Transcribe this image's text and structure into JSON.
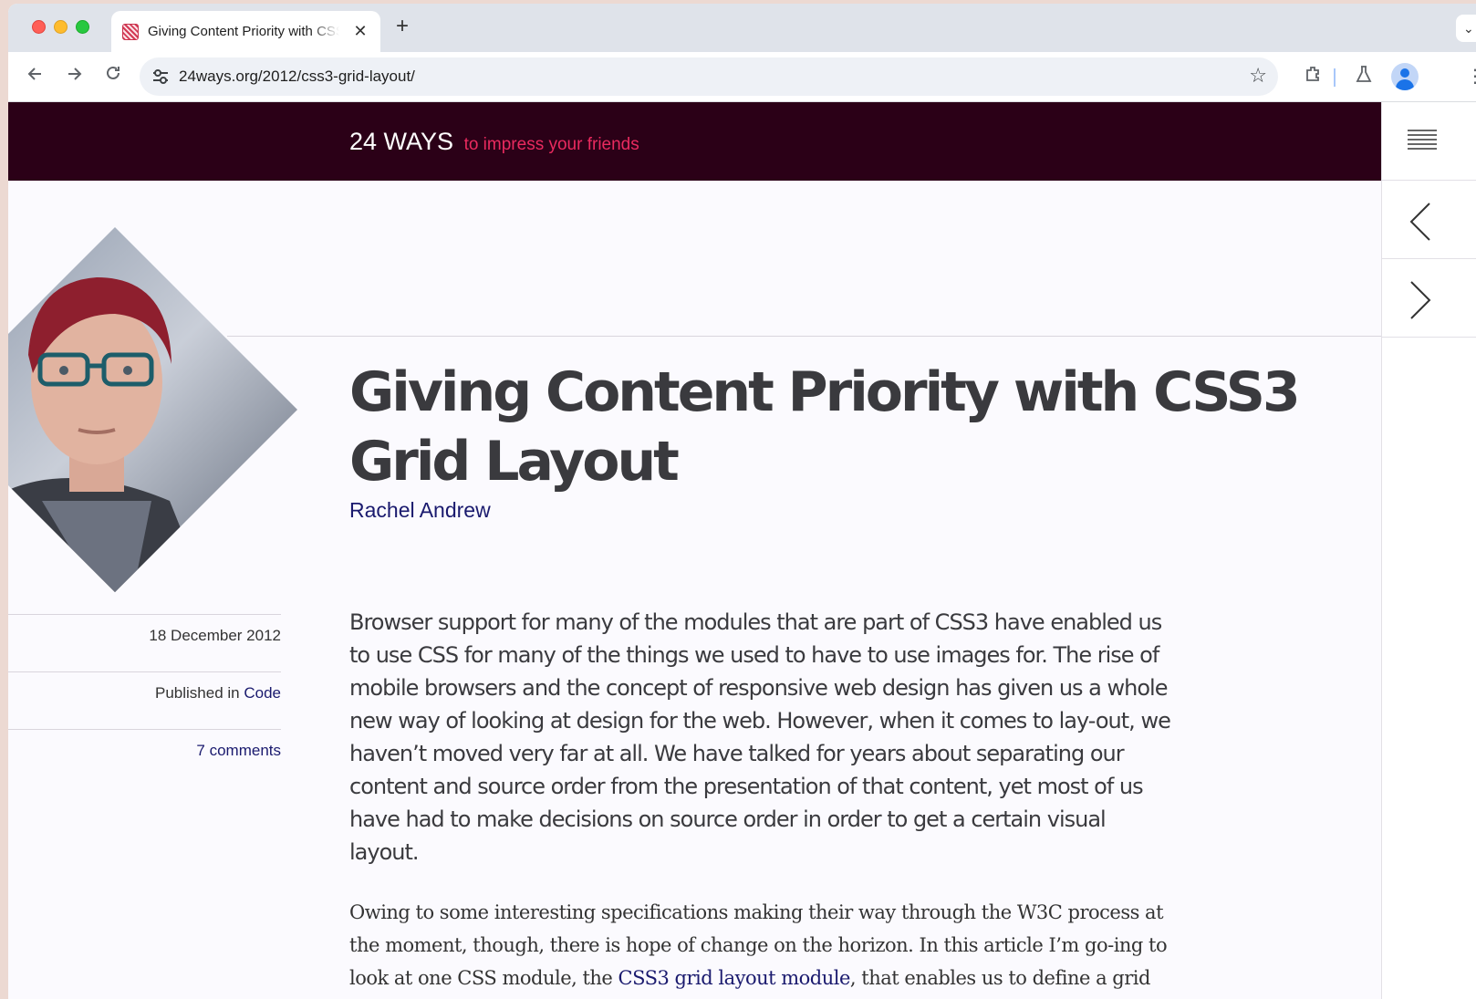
{
  "browser": {
    "tab": {
      "title": "Giving Content Priority with CSS3 Grid Layout"
    },
    "url": "24ways.org/2012/css3-grid-layout/"
  },
  "icons": {
    "back": "arrow-left-icon",
    "forward": "arrow-right-icon",
    "reload": "reload-icon",
    "site_info": "tune-icon",
    "bookmark": "star-icon",
    "extensions": "puzzle-icon",
    "labs": "flask-icon",
    "profile": "avatar-icon",
    "menu": "hamburger-icon",
    "prev": "chevron-left-icon",
    "next": "chevron-right-icon"
  },
  "site": {
    "brand": "24 WAYS",
    "tagline": "to impress your friends"
  },
  "article": {
    "title": "Giving Content Priority with CSS3 Grid Layout",
    "author": "Rachel Andrew",
    "date": "18 December 2012",
    "published_prefix": "Published in",
    "category": "Code",
    "comments": "7 comments",
    "lede": "Browser support for many of the modules that are part of CSS3 have enabled us to use CSS for many of the things we used to have to use images for. The rise of mobile browsers and the concept of responsive web design has given us a whole new way of looking at design for the web. However, when it comes to lay-out, we haven’t moved very far at all. We have talked for years about separating our content and source order from the presentation of that content, yet most of us have had to make decisions on source order in order to get a certain visual layout.",
    "para2_before": "Owing to some interesting specifications making their way through the W3C process at the moment, though, there is hope of change on the horizon. In this article I’m go-ing to look at one CSS module, the ",
    "para2_link": "CSS3 grid layout module",
    "para2_after": ", that enables us to define a grid"
  },
  "colors": {
    "header_bg": "#2b0017",
    "tagline": "#ea2a5f",
    "link": "#1a1a6e",
    "text": "#3a3a3e"
  }
}
